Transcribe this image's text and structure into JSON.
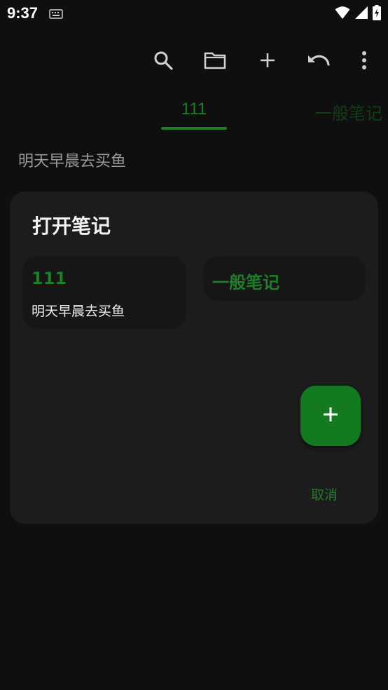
{
  "status_bar": {
    "time": "9:37",
    "icons": [
      "keyboard-icon",
      "wifi-icon",
      "signal-icon",
      "battery-charging-icon"
    ]
  },
  "toolbar": {
    "icons": [
      "search-icon",
      "folder-icon",
      "add-icon",
      "undo-icon",
      "more-vertical-icon"
    ]
  },
  "tabs": [
    {
      "label": "111",
      "active": true
    },
    {
      "label": "一般笔记",
      "active": false
    }
  ],
  "note_preview": "明天早晨去买鱼",
  "dialog": {
    "title": "打开笔记",
    "notebooks": [
      {
        "title": "111",
        "preview": "明天早晨去买鱼"
      },
      {
        "title": "一般笔记"
      }
    ],
    "fab_icon": "add-icon",
    "cancel_label": "取消"
  },
  "colors": {
    "background": "#0f0f0f",
    "dialog": "#1c1c1c",
    "card": "#161616",
    "accent": "#1e7d2a",
    "fab": "#137a22"
  }
}
